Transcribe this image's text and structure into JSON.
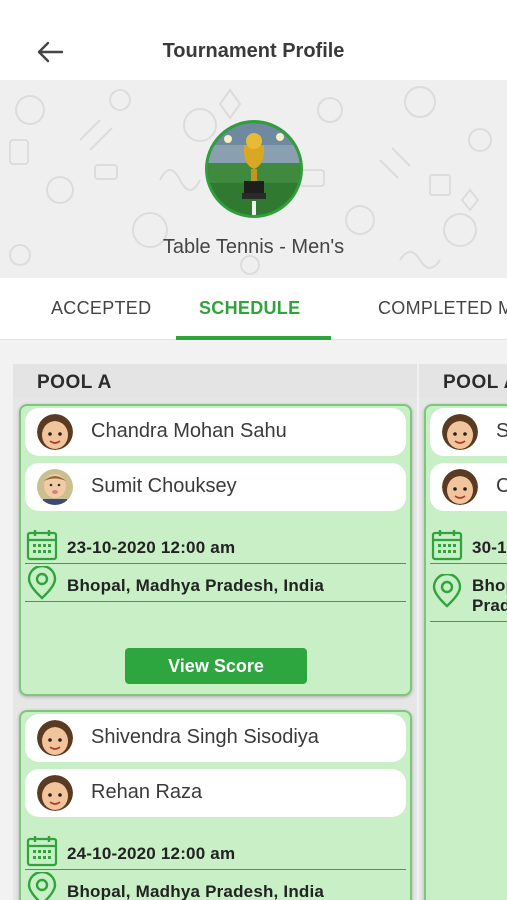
{
  "header": {
    "title": "Tournament Profile"
  },
  "hero": {
    "tournament_name": "Table Tennis - Men's"
  },
  "tabs": [
    {
      "label": "ACCEPTED",
      "active": false
    },
    {
      "label": "SCHEDULE",
      "active": true
    },
    {
      "label": "COMPLETED MATCHES",
      "active": false
    }
  ],
  "pools": [
    {
      "title": "POOL A",
      "matches": [
        {
          "player1": "Chandra Mohan Sahu",
          "player2": "Sumit Chouksey",
          "datetime": "23-10-2020 12:00 am",
          "location": "Bhopal, Madhya Pradesh, India",
          "button": "View Score"
        },
        {
          "player1": "Shivendra Singh Sisodiya",
          "player2": "Rehan Raza",
          "datetime": "24-10-2020 12:00 am",
          "location": "Bhopal, Madhya Pradesh, India"
        }
      ]
    },
    {
      "title": "POOL A",
      "matches": [
        {
          "player1": "S",
          "player2": "C",
          "datetime": "30-1(",
          "location_line1": "Bhop",
          "location_line2": "Prad"
        }
      ]
    }
  ],
  "colors": {
    "accent": "#2fa43c",
    "card_bg": "#c8efc6",
    "card_border": "#7cc878"
  }
}
